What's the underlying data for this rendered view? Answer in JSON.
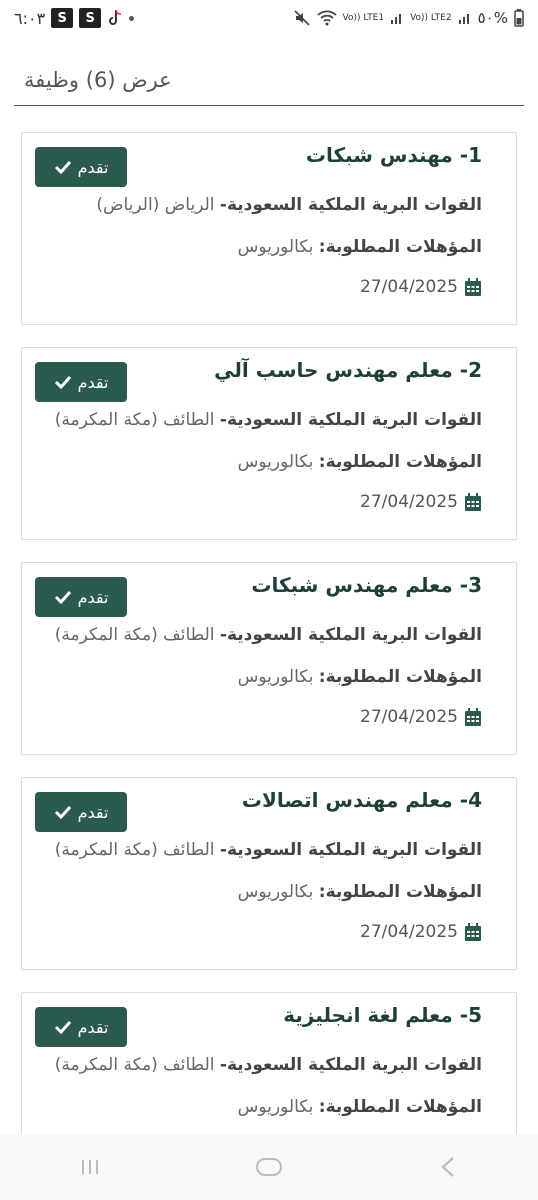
{
  "status_bar": {
    "time": "٦:٠٣",
    "battery": "٥٠%",
    "net1": "Vo)) LTE2",
    "net2": "Vo)) LTE1",
    "s_badge": "S"
  },
  "header": {
    "count_label": "عرض (6) وظيفة"
  },
  "jobs": [
    {
      "title": "1- مهندس شبكات",
      "employer_name": "القوات البرية الملكية السعودية-",
      "location": " الرياض (الرياض)",
      "qual_label": "المؤهلات المطلوبة:",
      "qual_value": " بكالوريوس",
      "date": "27/04/2025",
      "apply_label": "تقدم"
    },
    {
      "title": "2- معلم مهندس حاسب آلي",
      "employer_name": "القوات البرية الملكية السعودية-",
      "location": " الطائف (مكة المكرمة)",
      "qual_label": "المؤهلات المطلوبة:",
      "qual_value": " بكالوريوس",
      "date": "27/04/2025",
      "apply_label": "تقدم"
    },
    {
      "title": "3- معلم مهندس شبكات",
      "employer_name": "القوات البرية الملكية السعودية-",
      "location": " الطائف (مكة المكرمة)",
      "qual_label": "المؤهلات المطلوبة:",
      "qual_value": " بكالوريوس",
      "date": "27/04/2025",
      "apply_label": "تقدم"
    },
    {
      "title": "4- معلم مهندس اتصالات",
      "employer_name": "القوات البرية الملكية السعودية-",
      "location": " الطائف (مكة المكرمة)",
      "qual_label": "المؤهلات المطلوبة:",
      "qual_value": " بكالوريوس",
      "date": "27/04/2025",
      "apply_label": "تقدم"
    },
    {
      "title": "5- معلم لغة انجليزية",
      "employer_name": "القوات البرية الملكية السعودية-",
      "location": " الطائف (مكة المكرمة)",
      "qual_label": "المؤهلات المطلوبة:",
      "qual_value": " بكالوريوس",
      "date": "",
      "apply_label": "تقدم"
    }
  ],
  "colors": {
    "accent": "#2b5a4f",
    "title": "#1f3f3a"
  }
}
